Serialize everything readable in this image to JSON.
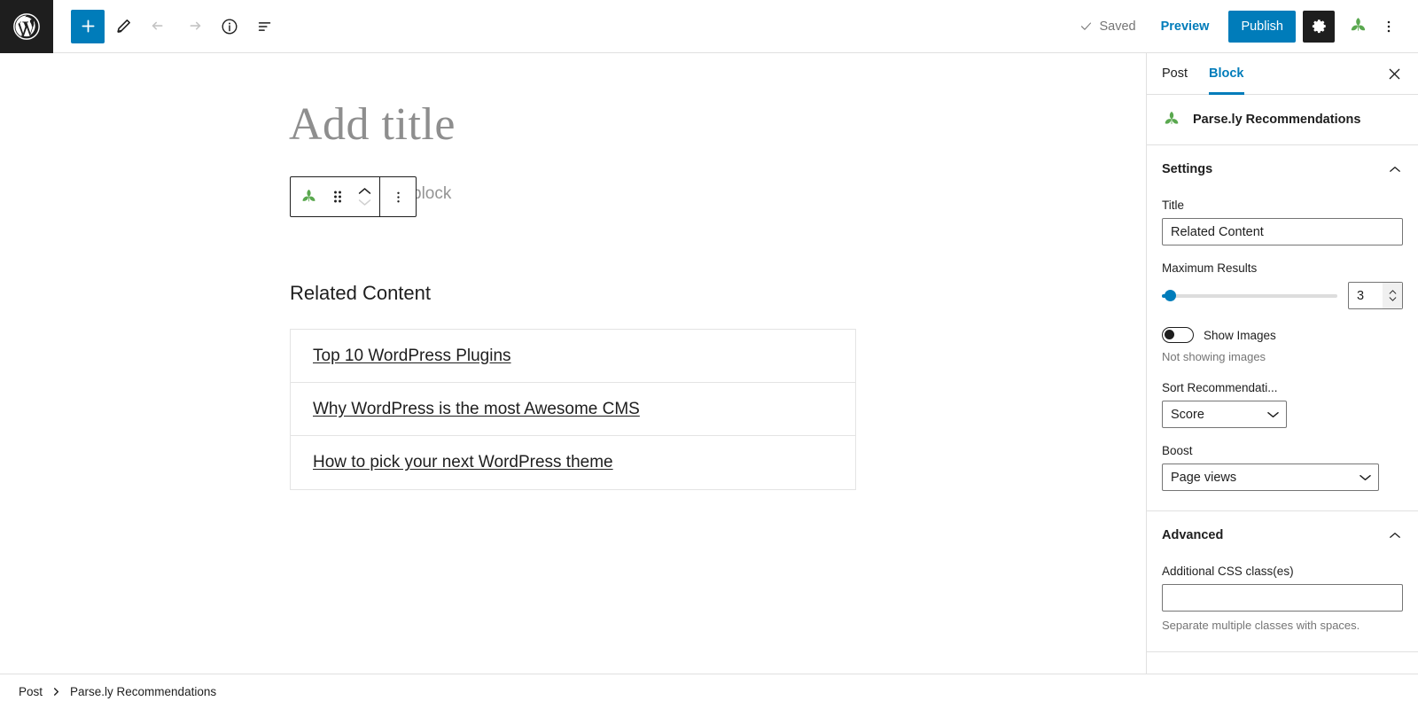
{
  "header": {
    "logo_icon": "wordpress-logo-icon",
    "add_block_icon": "plus-icon",
    "edit_icon": "pencil-icon",
    "undo_icon": "undo-arrow-icon",
    "redo_icon": "redo-arrow-icon",
    "info_icon": "info-circle-icon",
    "list_view_icon": "list-view-icon",
    "saved_label": "Saved",
    "saved_check_icon": "checkmark-icon",
    "preview_label": "Preview",
    "publish_label": "Publish",
    "settings_icon": "gear-icon",
    "parsely_icon": "parsely-leaf-icon",
    "more_icon": "vertical-ellipsis-icon"
  },
  "canvas": {
    "title_placeholder": "Add title",
    "block_placeholder": "block",
    "block_toolbar": {
      "block_type_icon": "parsely-leaf-icon",
      "drag_icon": "drag-handle-icon",
      "move_up_icon": "chevron-up-icon",
      "move_down_icon": "chevron-down-icon",
      "options_icon": "vertical-ellipsis-icon"
    },
    "recommendations_heading": "Related Content",
    "recommendations": [
      {
        "title": "Top 10 WordPress Plugins"
      },
      {
        "title": "Why WordPress is the most Awesome CMS"
      },
      {
        "title": "How to pick your next WordPress theme"
      }
    ]
  },
  "sidebar": {
    "tabs": [
      {
        "label": "Post",
        "active": false
      },
      {
        "label": "Block",
        "active": true
      }
    ],
    "close_icon": "close-x-icon",
    "block_card": {
      "icon": "parsely-leaf-icon",
      "name": "Parse.ly Recommendations"
    },
    "settings_panel": {
      "title": "Settings",
      "collapse_icon": "chevron-up-icon",
      "title_field": {
        "label": "Title",
        "value": "Related Content"
      },
      "max_results": {
        "label": "Maximum Results",
        "value": "3",
        "slider_percent": 5,
        "spinner_up_icon": "chevron-up-icon",
        "spinner_down_icon": "chevron-down-icon"
      },
      "show_images": {
        "label": "Show Images",
        "enabled": false,
        "help": "Not showing images"
      },
      "sort": {
        "label": "Sort Recommendati...",
        "value": "Score",
        "chevron_icon": "chevron-down-icon"
      },
      "boost": {
        "label": "Boost",
        "value": "Page views",
        "chevron_icon": "chevron-down-icon"
      }
    },
    "advanced_panel": {
      "title": "Advanced",
      "collapse_icon": "chevron-up-icon",
      "css_classes": {
        "label": "Additional CSS class(es)",
        "value": "",
        "help": "Separate multiple classes with spaces."
      }
    }
  },
  "footer": {
    "breadcrumbs": [
      {
        "label": "Post"
      },
      {
        "label": "Parse.ly Recommendations"
      }
    ],
    "separator_icon": "chevron-right-icon"
  },
  "colors": {
    "accent": "#007cba",
    "dark": "#1e1e1e",
    "parsely_green": "#5aa84f",
    "muted": "#757575",
    "border": "#e0e0e0"
  }
}
